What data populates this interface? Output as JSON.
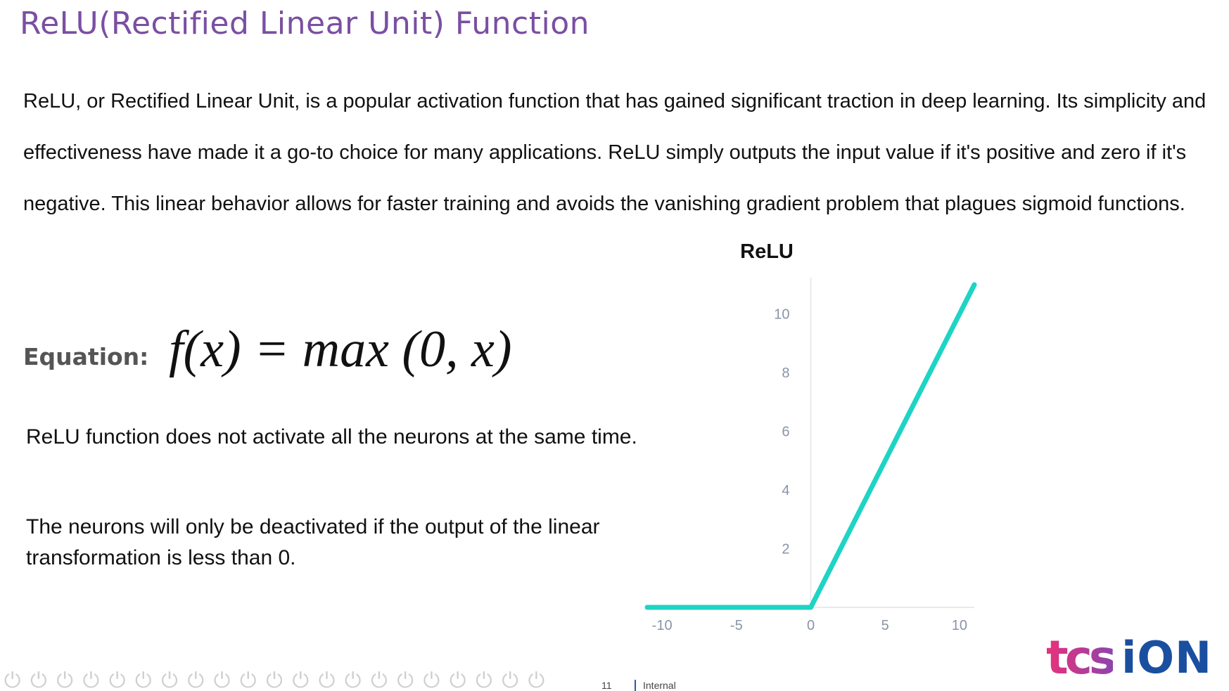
{
  "slide": {
    "title": "ReLU(Rectified Linear Unit) Function",
    "intro": "ReLU, or Rectified Linear Unit, is a popular activation function that has gained significant traction in deep learning. Its simplicity and effectiveness have made it a go-to choice for many applications. ReLU simply outputs the input value if it's positive and zero if it's negative. This linear behavior allows for faster training and avoids the vanishing gradient problem that plagues sigmoid functions.",
    "equation_label": "Equation:",
    "equation": "f(x) = max (0, x)",
    "paragraph_1": "ReLU function does not activate all the neurons at the same time.",
    "paragraph_2": "The neurons will only be deactivated if the output of the linear transformation is less than 0."
  },
  "footer": {
    "page_number": "11",
    "classification": "Internal",
    "logo_text_left": "tcs",
    "logo_text_right": "iON",
    "decor_icon": "power-symbol-icon"
  },
  "colors": {
    "title": "#7a4fa3",
    "line": "#1ed4c4",
    "axis_tick": "#8a93a8",
    "label_gray": "#555555",
    "logo_blue": "#1a4fa0"
  },
  "chart_data": {
    "type": "line",
    "title": "ReLU",
    "x": [
      -11,
      0,
      11
    ],
    "series": [
      {
        "name": "",
        "values": [
          0,
          0,
          11
        ]
      }
    ],
    "xticks": [
      -10,
      -5,
      0,
      5,
      10
    ],
    "yticks": [
      2,
      4,
      6,
      8,
      10
    ],
    "xlim": [
      -11,
      11
    ],
    "ylim": [
      0,
      11
    ],
    "xlabel": "",
    "ylabel": "",
    "grid": false,
    "legend": "none"
  }
}
